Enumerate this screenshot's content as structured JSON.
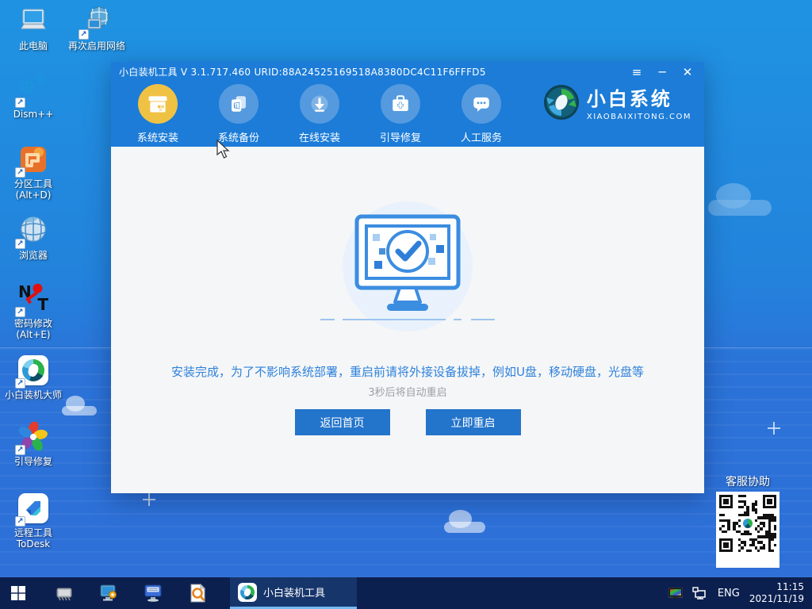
{
  "desktop": {
    "icons": [
      {
        "label": "此电脑"
      },
      {
        "label": "再次启用网络"
      },
      {
        "label": "Dism++"
      },
      {
        "label": "分区工具",
        "label2": "(Alt+D)"
      },
      {
        "label": "浏览器"
      },
      {
        "label": "密码修改",
        "label2": "(Alt+E)"
      },
      {
        "label": "小白装机大师"
      },
      {
        "label": "引导修复"
      },
      {
        "label": "远程工具",
        "label2": "ToDesk"
      }
    ],
    "support_label": "客服协助"
  },
  "app": {
    "title": "小白装机工具 V 3.1.717.460 URID:88A24525169518A8380DC4C11F6FFFD5",
    "window_controls": {
      "menu": "≡",
      "minimize": "─",
      "close": "✕"
    },
    "tabs": [
      {
        "label": "系统安装",
        "active": true
      },
      {
        "label": "系统备份",
        "active": false
      },
      {
        "label": "在线安装",
        "active": false
      },
      {
        "label": "引导修复",
        "active": false
      },
      {
        "label": "人工服务",
        "active": false
      }
    ],
    "logo": {
      "name": "小白系统",
      "domain": "XIAOBAIXITONG.COM"
    },
    "message": "安装完成，为了不影响系统部署，重启前请将外接设备拔掉，例如U盘，移动硬盘，光盘等",
    "countdown": "3秒后将自动重启",
    "back_button": "返回首页",
    "restart_button": "立即重启",
    "colors": {
      "header": "#1c7cd8",
      "accent_text": "#2e82dc",
      "button": "#2374cb",
      "active_tab": "#f0c244"
    }
  },
  "taskbar": {
    "active_task": "小白装机工具",
    "language": "ENG",
    "time": "11:15",
    "date": "2021/11/19"
  }
}
